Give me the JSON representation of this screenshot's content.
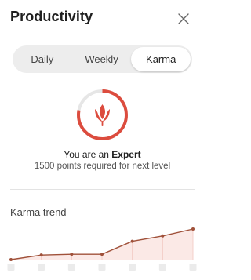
{
  "header": {
    "title": "Productivity",
    "close_icon": "close-icon"
  },
  "tabs": [
    {
      "label": "Daily",
      "active": false
    },
    {
      "label": "Weekly",
      "active": false
    },
    {
      "label": "Karma",
      "active": true
    }
  ],
  "karma": {
    "level_prefix": "You are an ",
    "level_name": "Expert",
    "points_text": "1500 points required for next level",
    "progress": 0.78,
    "accent_color": "#dc4c3e",
    "track_color": "#e6e6e6",
    "icon": "tulip-icon"
  },
  "trend": {
    "title": "Karma trend"
  },
  "chart_data": {
    "type": "area",
    "x": [
      1,
      2,
      3,
      4,
      5,
      6,
      7
    ],
    "series": [
      {
        "values": [
          0,
          6,
          7,
          7,
          24,
          31,
          40
        ]
      }
    ],
    "line_color": "#a0513a",
    "fill_color": "#fbe9e6",
    "grid": true
  }
}
